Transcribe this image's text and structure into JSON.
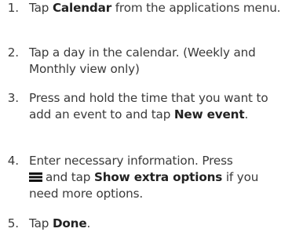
{
  "steps": [
    {
      "number": "1.",
      "before": "Tap ",
      "bold": "Calendar",
      "after": " from the applications menu."
    },
    {
      "number": "2.",
      "text": "Tap a day in the calendar. (Weekly and Monthly view only)"
    },
    {
      "number": "3.",
      "before": "Press and hold the time that you want to add an event to and tap ",
      "bold": "New event",
      "after": "."
    },
    {
      "number": "4.",
      "before": "Enter necessary information. Press ",
      "icon": "menu-icon",
      "middle": "and tap ",
      "bold": "Show extra options",
      "after": " if you need more options."
    },
    {
      "number": "5.",
      "before": "Tap ",
      "bold": "Done",
      "after": "."
    }
  ],
  "colors": {
    "text": "#3a3a3a",
    "bold_text": "#222222",
    "background": "#ffffff"
  }
}
